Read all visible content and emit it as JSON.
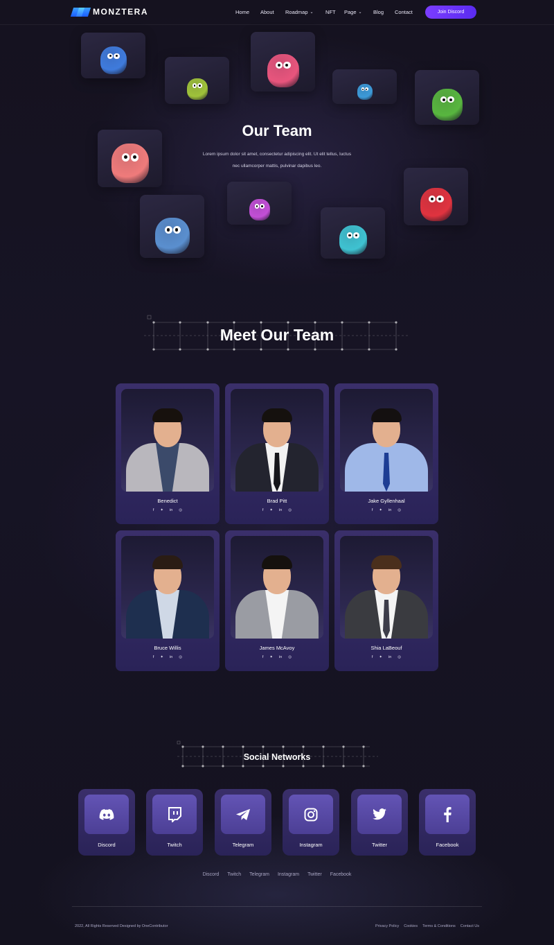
{
  "brand": {
    "name": "MONZTERA"
  },
  "nav": {
    "items": [
      {
        "label": "Home",
        "has_dropdown": false
      },
      {
        "label": "About",
        "has_dropdown": false
      },
      {
        "label": "Roadmap",
        "has_dropdown": true
      },
      {
        "label": "NFT",
        "has_dropdown": false
      },
      {
        "label": "Page",
        "has_dropdown": true
      },
      {
        "label": "Blog",
        "has_dropdown": false
      },
      {
        "label": "Contact",
        "has_dropdown": false
      }
    ],
    "cta": "Join Discord"
  },
  "hero": {
    "title": "Our Team",
    "description": "Lorem ipsum dolor sit amet, consectetur adipiscing elit. Ut elit tellus, luctus nec ullamcorper mattis, pulvinar dapibus leo."
  },
  "team": {
    "title": "Meet Our Team",
    "members": [
      {
        "name": "Benedict",
        "suit": "#b9b7bd",
        "shirt": "#3b4a6a",
        "tie": "",
        "hair": "#17110d"
      },
      {
        "name": "Brad Pitt",
        "suit": "#23242f",
        "shirt": "#f2f2f2",
        "tie": "#15151a",
        "hair": "#15110e"
      },
      {
        "name": "Jake Gyllenhaal",
        "suit": "#9fb8e8",
        "shirt": "#9fb8e8",
        "tie": "#1d3d94",
        "hair": "#141010"
      },
      {
        "name": "Bruce Willis",
        "suit": "#1e2f4f",
        "shirt": "#cfd8e6",
        "tie": "",
        "hair": "#2a1c14"
      },
      {
        "name": "James McAvoy",
        "suit": "#9a9ca3",
        "shirt": "#f4f4f4",
        "tie": "",
        "hair": "#15110e"
      },
      {
        "name": "Shia LaBeouf",
        "suit": "#3a3b40",
        "shirt": "#f4f4f4",
        "tie": "#3d3d4a",
        "hair": "#4a2f1c"
      }
    ],
    "social_glyphs": [
      "f",
      "✦",
      "in",
      "◎"
    ]
  },
  "social": {
    "title": "Social Networks",
    "cards": [
      {
        "label": "Discord",
        "icon": "discord-icon"
      },
      {
        "label": "Twitch",
        "icon": "twitch-icon"
      },
      {
        "label": "Telegram",
        "icon": "telegram-icon"
      },
      {
        "label": "Instagram",
        "icon": "instagram-icon"
      },
      {
        "label": "Twitter",
        "icon": "twitter-icon"
      },
      {
        "label": "Facebook",
        "icon": "facebook-icon"
      }
    ],
    "links": [
      "Discord",
      "Twitch",
      "Telegram",
      "Instagram",
      "Twitter",
      "Facebook"
    ]
  },
  "footer": {
    "copyright": "2022, All Rights Reserved Designed by OneContributor",
    "links": [
      "Privacy Policy",
      "Cookies",
      "Terms & Conditions",
      "Contact Us"
    ]
  },
  "colors": {
    "accent": "#7b3dff",
    "card": "#2f2860",
    "icon_tile": "#5a4aa8"
  }
}
